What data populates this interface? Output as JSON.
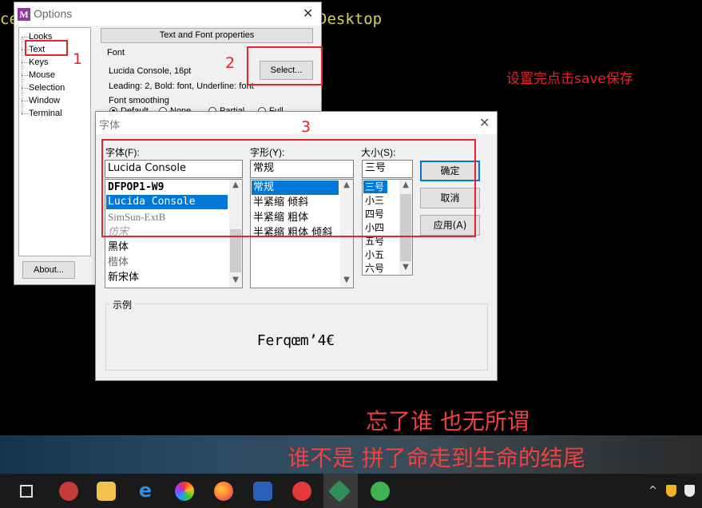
{
  "terminal": {
    "left_fragment": "ce",
    "right_fragment": "Desktop"
  },
  "options": {
    "title": "Options",
    "tree": [
      "Looks",
      "Text",
      "Keys",
      "Mouse",
      "Selection",
      "Window",
      "Terminal"
    ],
    "panel_header": "Text and Font properties",
    "font_group": "Font",
    "font_value": "Lucida Console, 16pt",
    "select_button": "Select...",
    "font_details": "Leading: 2, Bold: font, Underline: font",
    "smoothing_label": "Font smoothing",
    "smoothing_options": [
      "Default",
      "None",
      "Partial",
      "Full"
    ],
    "about_button": "About..."
  },
  "font_dialog": {
    "title": "字体",
    "font_label": "字体(F):",
    "style_label": "字形(Y):",
    "size_label": "大小(S):",
    "font_input": "Lucida Console",
    "style_input": "常规",
    "size_input": "三号",
    "fonts": [
      "DFPOP1-W9",
      "Lucida Console",
      "SimSun-ExtB",
      "仿宋",
      "黑体",
      "楷体",
      "新宋体"
    ],
    "styles": [
      "常规",
      "半紧缩 倾斜",
      "半紧缩 粗体",
      "半紧缩 粗体 倾斜"
    ],
    "sizes": [
      "三号",
      "小三",
      "四号",
      "小四",
      "五号",
      "小五",
      "六号"
    ],
    "ok_button": "确定",
    "cancel_button": "取消",
    "apply_button": "应用(A)",
    "sample_label": "示例",
    "sample_text": "Ferqœm’4€"
  },
  "annotations": {
    "n1": "1",
    "n2": "2",
    "n3": "3",
    "note": "设置完点击save保存",
    "color": "#e8212a"
  },
  "subtitles": {
    "line1": "忘了谁 也无所谓",
    "line2": "谁不是 拼了命走到生命的结尾"
  },
  "taskbar": {
    "icons": [
      "task-view-icon",
      "paint-icon",
      "file-explorer-icon",
      "edge-icon",
      "photos-icon",
      "firefox-icon",
      "network-app-icon",
      "netease-music-icon",
      "git-icon",
      "wechat-icon"
    ],
    "tray": [
      "chevron-up-icon",
      "shield-icon",
      "defender-icon"
    ]
  }
}
